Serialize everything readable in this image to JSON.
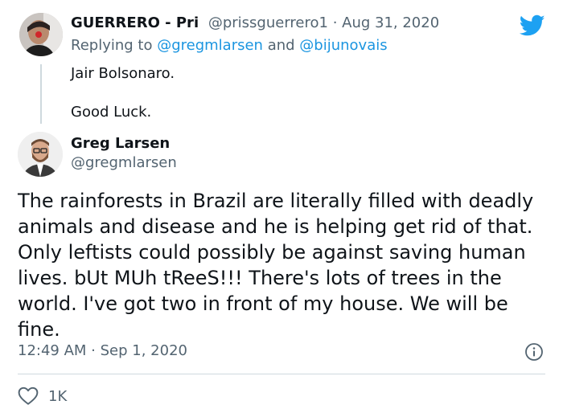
{
  "reply_tweet": {
    "display_name": "GUERRERO - Pri",
    "handle": "@prissguerrero1",
    "separator": " · ",
    "date": "Aug 31, 2020",
    "replying_prefix": "Replying to ",
    "mention_1": "@gregmlarsen",
    "conjunction": " and ",
    "mention_2": "@bijunovais",
    "text_line_1": "Jair Bolsonaro.",
    "text_line_2": "Good Luck."
  },
  "main_tweet": {
    "display_name": "Greg Larsen",
    "handle": "@gregmlarsen",
    "body": "The rainforests in Brazil are literally filled with deadly animals and disease and he is helping get rid of that. Only leftists could possibly be against saving human lives. bUt MUh tReeS!!! There's lots of trees in the world. I've got two in front of my house. We will be fine.",
    "time": "12:49 AM",
    "separator": " · ",
    "date": "Sep 1, 2020",
    "like_count": "1K"
  },
  "icons": {
    "brand": "twitter-bird-icon",
    "info": "info-icon",
    "like": "heart-icon"
  },
  "colors": {
    "brand_blue": "#1da1f2",
    "link_blue": "#1b95e0",
    "secondary_text": "#536471",
    "divider": "#cfd9de"
  }
}
